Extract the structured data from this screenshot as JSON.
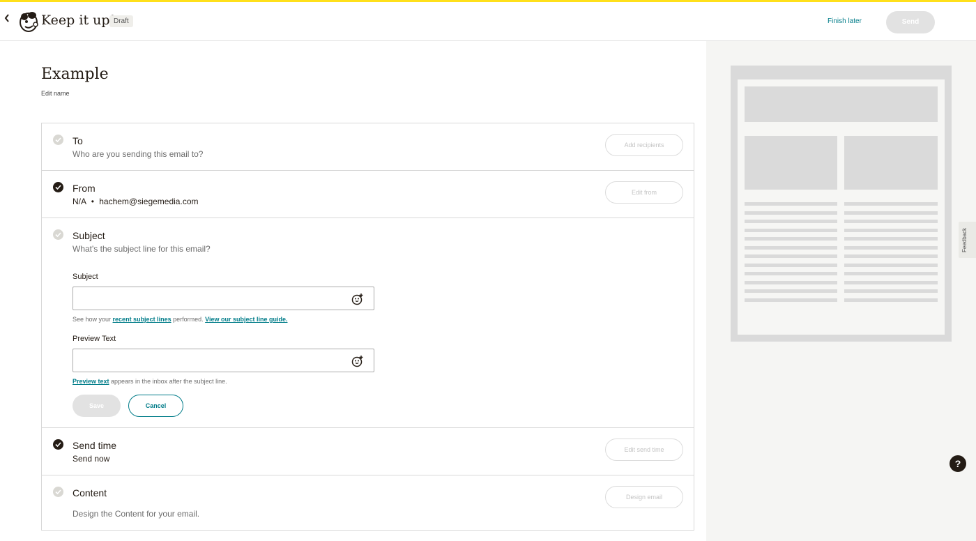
{
  "header": {
    "app_title": "Keep it up!",
    "status_badge": "Draft",
    "finish_later": "Finish later",
    "send": "Send"
  },
  "campaign": {
    "name": "Example",
    "edit_name": "Edit name"
  },
  "checklist": {
    "to": {
      "title": "To",
      "subtitle": "Who are you sending this email to?",
      "button": "Add recipients",
      "status": "pending"
    },
    "from": {
      "title": "From",
      "subtitle_name": "N/A",
      "subtitle_separator": "•",
      "subtitle_email": "hachem@siegemedia.com",
      "button": "Edit from",
      "status": "done"
    },
    "subject": {
      "title": "Subject",
      "subtitle": "What's the subject line for this email?",
      "status": "pending",
      "subject_label": "Subject",
      "subject_value": "",
      "subject_help_prefix": "See how your ",
      "subject_help_link1": "recent subject lines",
      "subject_help_mid": " performed. ",
      "subject_help_link2": "View our subject line guide.",
      "preview_label": "Preview Text",
      "preview_value": "",
      "preview_help_link": "Preview text",
      "preview_help_suffix": " appears in the inbox after the subject line.",
      "save": "Save",
      "cancel": "Cancel"
    },
    "send_time": {
      "title": "Send time",
      "subtitle": "Send now",
      "button": "Edit send time",
      "status": "done"
    },
    "content": {
      "title": "Content",
      "subtitle": "Design the Content for your email.",
      "button": "Design email",
      "status": "pending"
    }
  },
  "sidebar": {
    "feedback": "Feedback",
    "help": "?"
  },
  "colors": {
    "accent_yellow": "#ffe01b",
    "link_teal": "#007c89",
    "check_done": "#241c15",
    "check_pending": "#d9d8d3"
  }
}
